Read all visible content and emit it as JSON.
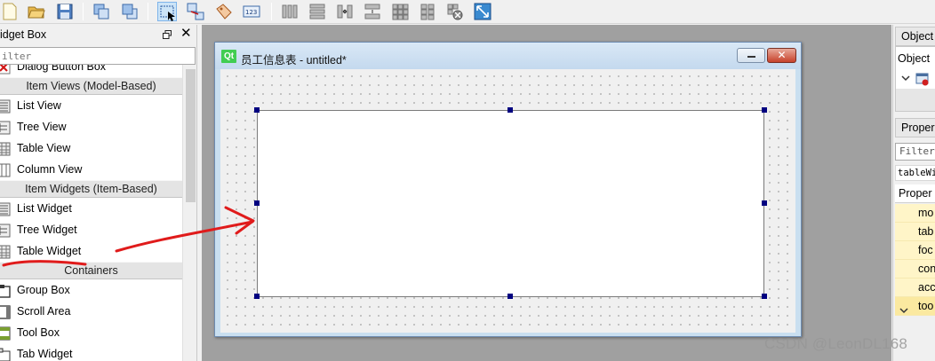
{
  "toolbar": {
    "buttons": [
      "new-file",
      "open-folder",
      "save",
      "bring-to-front",
      "send-to-back",
      "edit-widgets",
      "edit-signals-slots",
      "edit-buddies",
      "edit-tab-order",
      "layout-horizontal",
      "layout-vertical",
      "layout-h-splitter",
      "layout-v-splitter",
      "layout-grid",
      "layout-form",
      "break-layout",
      "adjust-size"
    ],
    "active": "edit-widgets"
  },
  "widget_box": {
    "title": "idget Box",
    "filter_placeholder": "ilter",
    "categories": [
      {
        "label": "Item Views (Model-Based)"
      },
      {
        "label": "Item Widgets (Item-Based)"
      },
      {
        "label": "Containers"
      }
    ],
    "items": [
      {
        "label": "Dialog Button Box",
        "icon": "dialog-button-box-icon"
      },
      {
        "label": "List View",
        "icon": "list-view-icon"
      },
      {
        "label": "Tree View",
        "icon": "tree-view-icon"
      },
      {
        "label": "Table View",
        "icon": "table-view-icon"
      },
      {
        "label": "Column View",
        "icon": "column-view-icon"
      },
      {
        "label": "List Widget",
        "icon": "list-widget-icon"
      },
      {
        "label": "Tree Widget",
        "icon": "tree-widget-icon"
      },
      {
        "label": "Table Widget",
        "icon": "table-widget-icon"
      },
      {
        "label": "Group Box",
        "icon": "group-box-icon"
      },
      {
        "label": "Scroll Area",
        "icon": "scroll-area-icon"
      },
      {
        "label": "Tool Box",
        "icon": "tool-box-icon"
      },
      {
        "label": "Tab Widget",
        "icon": "tab-widget-icon"
      }
    ]
  },
  "form_window": {
    "logo": "Qt",
    "title": "员工信息表 - untitled*",
    "close_glyph": "✕"
  },
  "object_inspector": {
    "title": "Object",
    "column_header": "Object"
  },
  "property_editor": {
    "title": "Proper",
    "filter_placeholder": "Filter",
    "class_label": "tableWi",
    "column_header": "Proper",
    "rows": [
      "mo",
      "tab",
      "foc",
      "con",
      "acc",
      "too"
    ]
  },
  "annotation_color": "#e01b1b",
  "selection_handle_color": "#000080",
  "watermark": "CSDN @LeonDL168"
}
